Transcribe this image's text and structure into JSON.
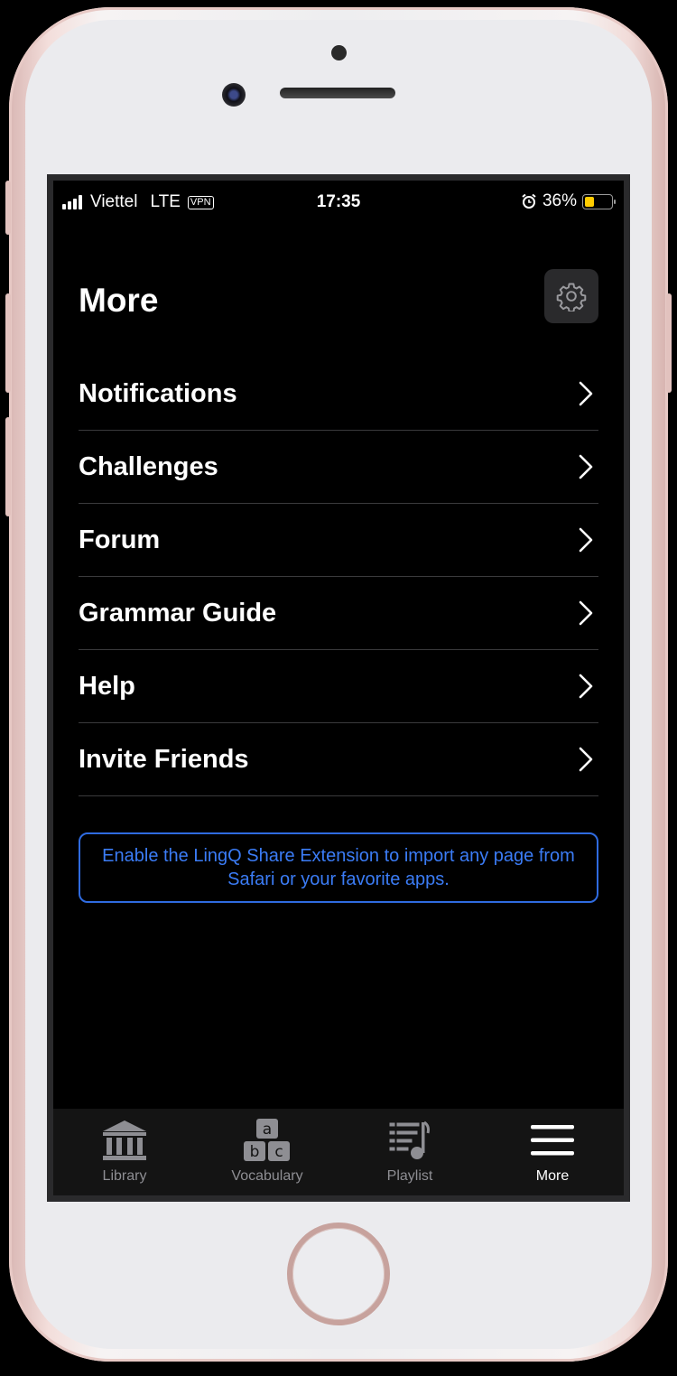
{
  "status_bar": {
    "carrier": "Viettel",
    "network": "LTE",
    "vpn": "VPN",
    "time": "17:35",
    "battery_percent": "36%",
    "battery_level": 0.36,
    "battery_color": "#ffcc00"
  },
  "header": {
    "title": "More",
    "settings_icon": "gear-icon"
  },
  "menu": {
    "items": [
      {
        "label": "Notifications"
      },
      {
        "label": "Challenges"
      },
      {
        "label": "Forum"
      },
      {
        "label": "Grammar Guide"
      },
      {
        "label": "Help"
      },
      {
        "label": "Invite Friends"
      }
    ]
  },
  "banner": {
    "text": "Enable the LingQ Share Extension to import any page from Safari or your favorite apps.",
    "color": "#3b7cf6"
  },
  "tabbar": {
    "tabs": [
      {
        "label": "Library",
        "icon": "library-icon",
        "active": false
      },
      {
        "label": "Vocabulary",
        "icon": "vocabulary-icon",
        "active": false
      },
      {
        "label": "Playlist",
        "icon": "playlist-icon",
        "active": false
      },
      {
        "label": "More",
        "icon": "menu-icon",
        "active": true
      }
    ],
    "active_color": "#ffffff",
    "inactive_color": "#8e8e93"
  }
}
